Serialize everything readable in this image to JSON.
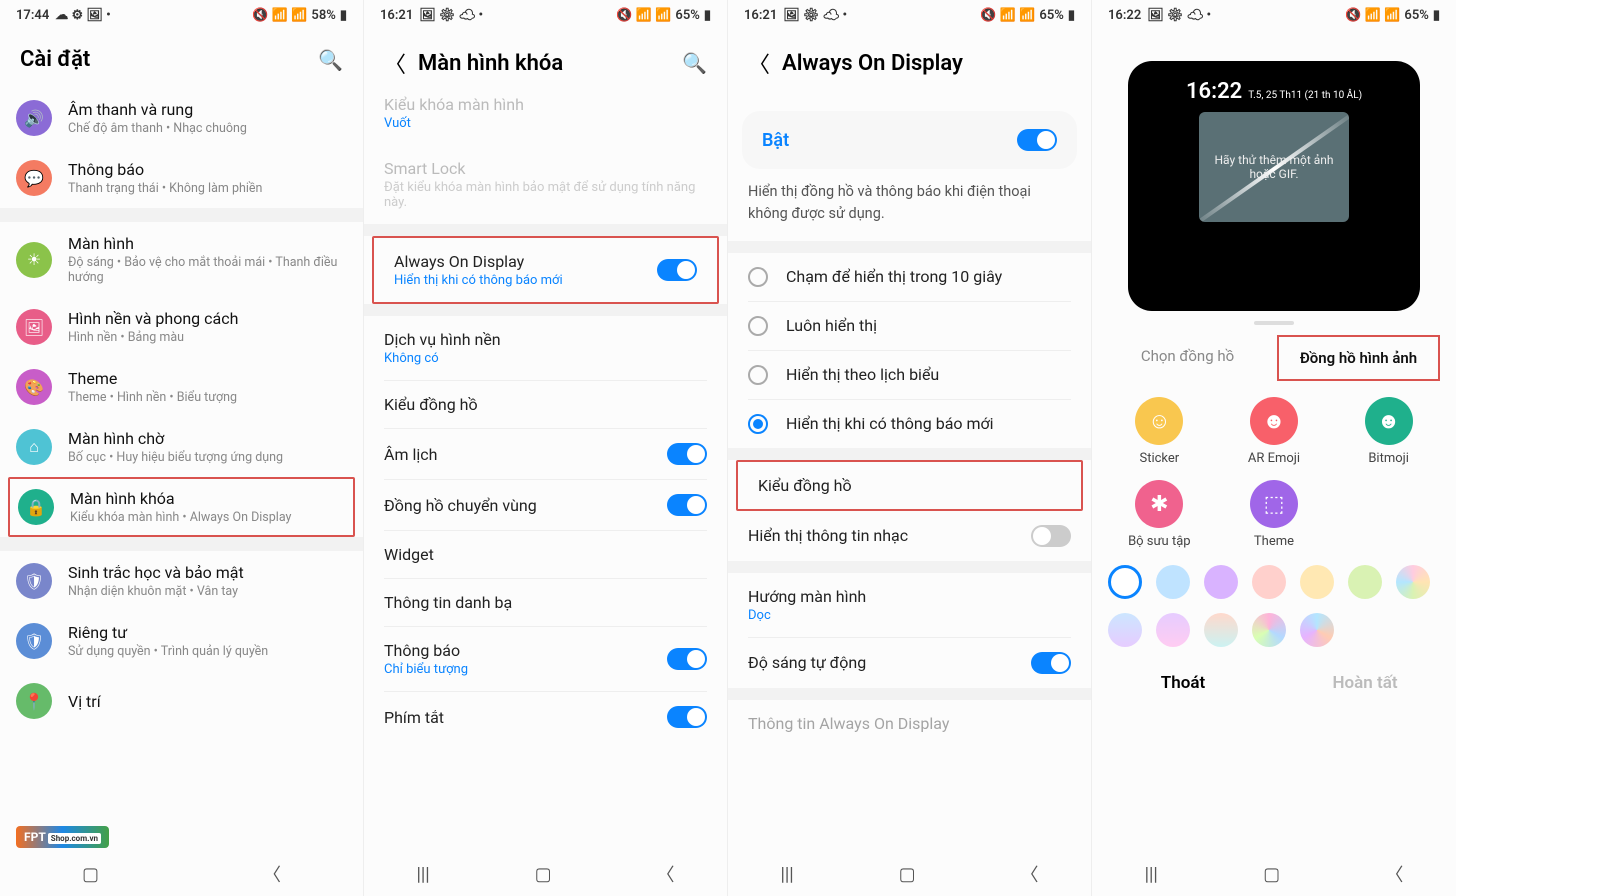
{
  "panel1": {
    "status_time": "17:44",
    "status_battery": "58%",
    "header": "Cài đặt",
    "items": [
      {
        "icon": "volume",
        "color": "#8b6bd6",
        "title": "Âm thanh và rung",
        "sub": "Chế độ âm thanh • Nhạc chuông"
      },
      {
        "icon": "bell",
        "color": "#f47b62",
        "title": "Thông báo",
        "sub": "Thanh trạng thái • Không làm phiền"
      },
      {
        "gap": true
      },
      {
        "icon": "sun",
        "color": "#8bc34a",
        "title": "Màn hình",
        "sub": "Độ sáng • Bảo vệ cho mắt thoải mái • Thanh điều hướng"
      },
      {
        "icon": "image",
        "color": "#e85d88",
        "title": "Hình nền và phong cách",
        "sub": "Hình nền • Bảng màu"
      },
      {
        "icon": "palette",
        "color": "#c85dc8",
        "title": "Theme",
        "sub": "Theme • Hình nền • Biểu tượng"
      },
      {
        "icon": "home",
        "color": "#4fc3d4",
        "title": "Màn hình chờ",
        "sub": "Bố cục • Huy hiệu biểu tượng ứng dụng"
      },
      {
        "icon": "lock",
        "color": "#1fb08c",
        "title": "Màn hình khóa",
        "sub": "Kiểu khóa màn hình • Always On Display",
        "highlight": true
      },
      {
        "gap": true
      },
      {
        "icon": "shield",
        "color": "#7986cb",
        "title": "Sinh trắc học và bảo mật",
        "sub": "Nhận diện khuôn mặt • Vân tay"
      },
      {
        "icon": "shield2",
        "color": "#5b8dd6",
        "title": "Riêng tư",
        "sub": "Sử dụng quyền • Trình quản lý quyền"
      },
      {
        "icon": "pin",
        "color": "#66bb6a",
        "title": "Vị trí",
        "sub": ""
      }
    ]
  },
  "panel2": {
    "status_time": "16:21",
    "status_battery": "65%",
    "header": "Màn hình khóa",
    "items": [
      {
        "title": "Kiểu khóa màn hình",
        "sub_blue": "Vuốt",
        "cut_top": true
      },
      {
        "title": "Smart Lock",
        "sub": "Đặt kiểu khóa màn hình bảo mật để sử dụng tính năng này.",
        "disabled": true
      },
      {
        "divider": true
      },
      {
        "title": "Always On Display",
        "sub_blue": "Hiển thị khi có thông báo mới",
        "toggle": true,
        "on": true,
        "highlight": true
      },
      {
        "divider": true
      },
      {
        "title": "Dịch vụ hình nền",
        "sub_blue": "Không có"
      },
      {
        "divider": true
      },
      {
        "title": "Kiểu đồng hồ"
      },
      {
        "divider": true
      },
      {
        "title": "Âm lịch",
        "toggle": true,
        "on": true
      },
      {
        "divider": true
      },
      {
        "title": "Đồng hồ chuyển vùng",
        "toggle": true,
        "on": true
      },
      {
        "divider": true
      },
      {
        "title": "Widget"
      },
      {
        "divider": true
      },
      {
        "title": "Thông tin danh bạ"
      },
      {
        "divider": true
      },
      {
        "title": "Thông báo",
        "sub_blue": "Chỉ biểu tượng",
        "toggle": true,
        "on": true
      },
      {
        "divider": true
      },
      {
        "title": "Phím tắt",
        "toggle": true,
        "on": true
      }
    ]
  },
  "panel3": {
    "status_time": "16:21",
    "status_battery": "65%",
    "header": "Always On Display",
    "enable_label": "Bật",
    "desc": "Hiển thị đồng hồ và thông báo khi điện thoại không được sử dụng.",
    "radios": [
      {
        "label": "Chạm để hiển thị trong 10 giây",
        "checked": false
      },
      {
        "label": "Luôn hiển thị",
        "checked": false
      },
      {
        "label": "Hiển thị theo lịch biểu",
        "checked": false
      },
      {
        "label": "Hiển thị khi có thông báo mới",
        "checked": true
      }
    ],
    "items": [
      {
        "title": "Kiểu đồng hồ",
        "highlight": true
      },
      {
        "title": "Hiển thị thông tin nhạc",
        "toggle": true,
        "on": false
      },
      {
        "gap": true
      },
      {
        "title": "Hướng màn hình",
        "sub_blue": "Dọc"
      },
      {
        "title": "Độ sáng tự động",
        "toggle": true,
        "on": true
      },
      {
        "gap": true
      },
      {
        "title": "Thông tin Always On Display",
        "cut": true
      }
    ]
  },
  "panel4": {
    "status_time": "16:22",
    "status_battery": "65%",
    "preview_time": "16:22",
    "preview_date": "T.5, 25 Th11 (21 th 10 ÂL)",
    "preview_text": "Hãy thử thêm một ảnh hoặc GIF.",
    "tabs": [
      {
        "label": "Chọn đồng hồ",
        "active": false
      },
      {
        "label": "Đồng hồ hình ảnh",
        "active": true
      }
    ],
    "options": [
      {
        "label": "Sticker",
        "color": "#f9c74f",
        "emoji": "☺"
      },
      {
        "label": "AR Emoji",
        "color": "#f8606a",
        "emoji": "☻"
      },
      {
        "label": "Bitmoji",
        "color": "#1fb08c",
        "emoji": "☻"
      },
      {
        "label": "Bộ sưu tập",
        "color": "#f0628e",
        "emoji": "✱"
      },
      {
        "label": "Theme",
        "color": "#a066e8",
        "emoji": "▼"
      }
    ],
    "footer_exit": "Thoát",
    "footer_done": "Hoàn tất"
  }
}
